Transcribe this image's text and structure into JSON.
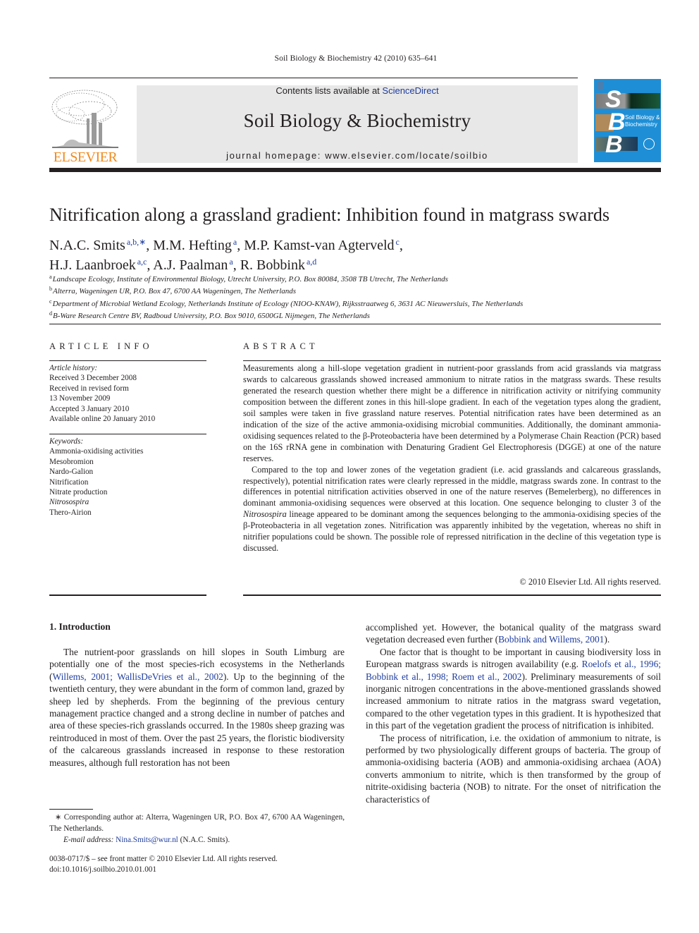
{
  "header": {
    "running_head": "Soil Biology & Biochemistry 42 (2010) 635–641",
    "publisher_logo_text": "ELSEVIER",
    "contents_prefix": "Contents lists available at ",
    "contents_link": "ScienceDirect",
    "journal_name": "Soil Biology & Biochemistry",
    "homepage": "journal homepage: www.elsevier.com/locate/soilbio",
    "cover": {
      "letters": [
        "S",
        "B",
        "B"
      ],
      "title_line1": "Soil Biology &",
      "title_line2": "Biochemistry"
    }
  },
  "article": {
    "title": "Nitrification along a grassland gradient: Inhibition found in matgrass swards",
    "authors_line1": [
      {
        "name": "N.A.C. Smits",
        "sup": "a,b,∗",
        "sep": ", "
      },
      {
        "name": "M.M. Hefting",
        "sup": "a",
        "sep": ", "
      },
      {
        "name": "M.P. Kamst-van Agterveld",
        "sup": "c",
        "sep": ","
      }
    ],
    "authors_line2": [
      {
        "name": "H.J. Laanbroek",
        "sup": "a,c",
        "sep": ", "
      },
      {
        "name": "A.J. Paalman",
        "sup": "a",
        "sep": ", "
      },
      {
        "name": "R. Bobbink",
        "sup": "a,d",
        "sep": ""
      }
    ],
    "affiliations": [
      {
        "mark": "a",
        "text": "Landscape Ecology, Institute of Environmental Biology, Utrecht University, P.O. Box 80084, 3508 TB Utrecht, The Netherlands"
      },
      {
        "mark": "b",
        "text": "Alterra, Wageningen UR, P.O. Box 47, 6700 AA Wageningen, The Netherlands"
      },
      {
        "mark": "c",
        "text": "Department of Microbial Wetland Ecology, Netherlands Institute of Ecology (NIOO-KNAW), Rijksstraatweg 6, 3631 AC Nieuwersluis, The Netherlands"
      },
      {
        "mark": "d",
        "text": "B-Ware Research Centre BV, Radboud University, P.O. Box 9010, 6500GL Nijmegen, The Netherlands"
      }
    ]
  },
  "article_info": {
    "heading": "ARTICLE INFO",
    "history_label": "Article history:",
    "history": [
      "Received 3 December 2008",
      "Received in revised form",
      "13 November 2009",
      "Accepted 3 January 2010",
      "Available online 20 January 2010"
    ],
    "keywords_label": "Keywords:",
    "keywords": [
      {
        "text": "Ammonia-oxidising activities",
        "italic": false
      },
      {
        "text": "Mesobromion",
        "italic": false
      },
      {
        "text": "Nardo-Galion",
        "italic": false
      },
      {
        "text": "Nitrification",
        "italic": false
      },
      {
        "text": "Nitrate production",
        "italic": false
      },
      {
        "text": "Nitrosospira",
        "italic": true
      },
      {
        "text": "Thero-Airion",
        "italic": false
      }
    ]
  },
  "abstract": {
    "heading": "ABSTRACT",
    "p1": "Measurements along a hill-slope vegetation gradient in nutrient-poor grasslands from acid grasslands via matgrass swards to calcareous grasslands showed increased ammonium to nitrate ratios in the matgrass swards. These results generated the research question whether there might be a difference in nitrification activity or nitrifying community composition between the different zones in this hill-slope gradient. In each of the vegetation types along the gradient, soil samples were taken in five grassland nature reserves. Potential nitrification rates have been determined as an indication of the size of the active ammonia-oxidising microbial communities. Additionally, the dominant ammonia-oxidising sequences related to the β-Proteobacteria have been determined by a Polymerase Chain Reaction (PCR) based on the 16S rRNA gene in combination with Denaturing Gradient Gel Electrophoresis (DGGE) at one of the nature reserves.",
    "p2_before_italic": "Compared to the top and lower zones of the vegetation gradient (i.e. acid grasslands and calcareous grasslands, respectively), potential nitrification rates were clearly repressed in the middle, matgrass swards zone. In contrast to the differences in potential nitrification activities observed in one of the nature reserves (Bemelerberg), no differences in dominant ammonia-oxidising sequences were observed at this location. One sequence belonging to cluster 3 of the ",
    "p2_italic": "Nitrosospira",
    "p2_after_italic": " lineage appeared to be dominant among the sequences belonging to the ammonia-oxidising species of the β-Proteobacteria in all vegetation zones. Nitrification was apparently inhibited by the vegetation, whereas no shift in nitrifier populations could be shown. The possible role of repressed nitrification in the decline of this vegetation type is discussed.",
    "copyright": "© 2010 Elsevier Ltd. All rights reserved."
  },
  "body": {
    "section_title": "1.  Introduction",
    "left": {
      "p1_a": "The nutrient-poor grasslands on hill slopes in South Limburg are potentially one of the most species-rich ecosystems in the Netherlands (",
      "p1_cite": "Willems, 2001; WallisDeVries et al., 2002",
      "p1_b": "). Up to the beginning of the twentieth century, they were abundant in the form of common land, grazed by sheep led by shepherds. From the beginning of the previous century management practice changed and a strong decline in number of patches and area of these species-rich grasslands occurred. In the 1980s sheep grazing was reintroduced in most of them. Over the past 25 years, the floristic biodiversity of the calcareous grasslands increased in response to these restoration measures, although full restoration has not been"
    },
    "right": {
      "p1_a": "accomplished yet. However, the botanical quality of the matgrass sward vegetation decreased even further (",
      "p1_cite": "Bobbink and Willems, 2001",
      "p1_b": ").",
      "p2_a": "One factor that is thought to be important in causing biodiversity loss in European matgrass swards is nitrogen availability (e.g. ",
      "p2_cite": "Roelofs et al., 1996; Bobbink et al., 1998; Roem et al., 2002",
      "p2_b": "). Preliminary measurements of soil inorganic nitrogen concentrations in the above-mentioned grasslands showed increased ammonium to nitrate ratios in the matgrass sward vegetation, compared to the other vegetation types in this gradient. It is hypothesized that in this part of the vegetation gradient the process of nitrification is inhibited.",
      "p3": "The process of nitrification, i.e. the oxidation of ammonium to nitrate, is performed by two physiologically different groups of bacteria. The group of ammonia-oxidising bacteria (AOB) and ammonia-oxidising archaea (AOA) converts ammonium to nitrite, which is then transformed by the group of nitrite-oxidising bacteria (NOB) to nitrate. For the onset of nitrification the characteristics of"
    }
  },
  "footnotes": {
    "corresponding": "∗ Corresponding author at: Alterra, Wageningen UR, P.O. Box 47, 6700 AA Wageningen, The Netherlands.",
    "email_label": "E-mail address: ",
    "email": "Nina.Smits@wur.nl",
    "email_suffix": " (N.A.C. Smits).",
    "issn": "0038-0717/$ – see front matter © 2010 Elsevier Ltd. All rights reserved.",
    "doi": "doi:10.1016/j.soilbio.2010.01.001"
  },
  "colors": {
    "text": "#231f20",
    "link": "#1f3d9e",
    "elsevier_orange": "#f08a1c",
    "banner_gray": "#e8e8e8",
    "cover_blue": "#1e8fd6"
  }
}
